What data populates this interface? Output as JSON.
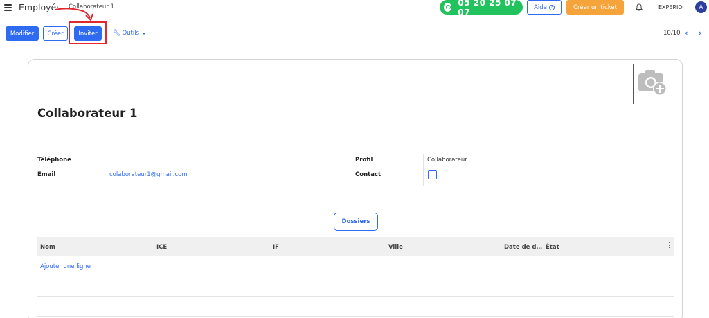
{
  "header": {
    "app_title": "Employés",
    "breadcrumb_current": "Collaborateur 1",
    "phone_number": "05 20 25 07 07",
    "help_label": "Aide",
    "ticket_label": "Créer un ticket",
    "company_name": "EXPERIO",
    "avatar_initial": "A"
  },
  "toolbar": {
    "edit_label": "Modifier",
    "create_label": "Créer",
    "invite_label": "Inviter",
    "tools_label": "Outils",
    "pager_text": "10/10"
  },
  "record": {
    "title": "Collaborateur 1",
    "fields": {
      "phone_label": "Téléphone",
      "phone_value": "",
      "email_label": "Email",
      "email_value": "colaborateur1@gmail.com",
      "profile_label": "Profil",
      "profile_value": "Collaborateur",
      "contact_label": "Contact",
      "contact_checked": false
    },
    "dossiers_label": "Dossiers",
    "table": {
      "columns": [
        "Nom",
        "ICE",
        "IF",
        "Ville",
        "Date de d…",
        "État"
      ],
      "add_line_label": "Ajouter une ligne"
    }
  },
  "colors": {
    "primary": "#2f6bf0",
    "phone_green": "#22c35e",
    "ticket_orange": "#f5a43b",
    "annotation_red": "#e0282e",
    "avatar_bg": "#2c3e9e"
  },
  "icons": [
    "menu-icon",
    "headset-icon",
    "help-icon",
    "bell-icon",
    "wrench-icon",
    "chevron-left-icon",
    "chevron-right-icon",
    "camera-add-icon",
    "kebab-icon"
  ]
}
